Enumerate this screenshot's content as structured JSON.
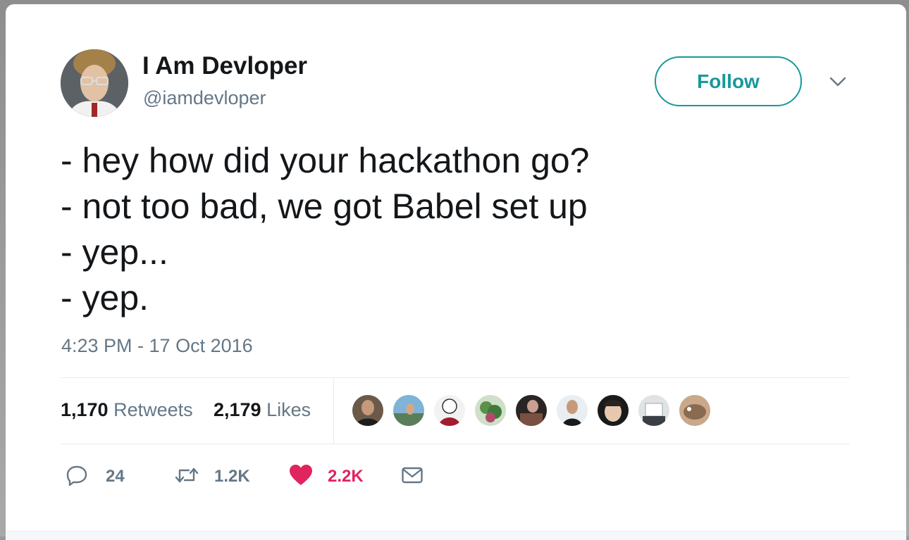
{
  "header": {
    "display_name": "I Am Devloper",
    "handle": "@iamdevloper",
    "follow_label": "Follow",
    "menu_icon": "chevron-down-icon"
  },
  "tweet": {
    "lines": [
      "- hey how did your hackathon go?",
      "- not too bad, we got Babel set up",
      "- yep...",
      "- yep."
    ],
    "timestamp": "4:23 PM - 17 Oct 2016"
  },
  "stats": {
    "retweets_count": "1,170",
    "retweets_label": "Retweets",
    "likes_count": "2,179",
    "likes_label": "Likes",
    "likers_shown": 9
  },
  "actions": {
    "reply_count": "24",
    "retweet_count": "1.2K",
    "like_count": "2.2K",
    "liked": true
  },
  "colors": {
    "accent": "#17999b",
    "like_red": "#e0245e",
    "text_primary": "#14171a",
    "text_secondary": "#657786",
    "divider": "#e6ecf0"
  }
}
